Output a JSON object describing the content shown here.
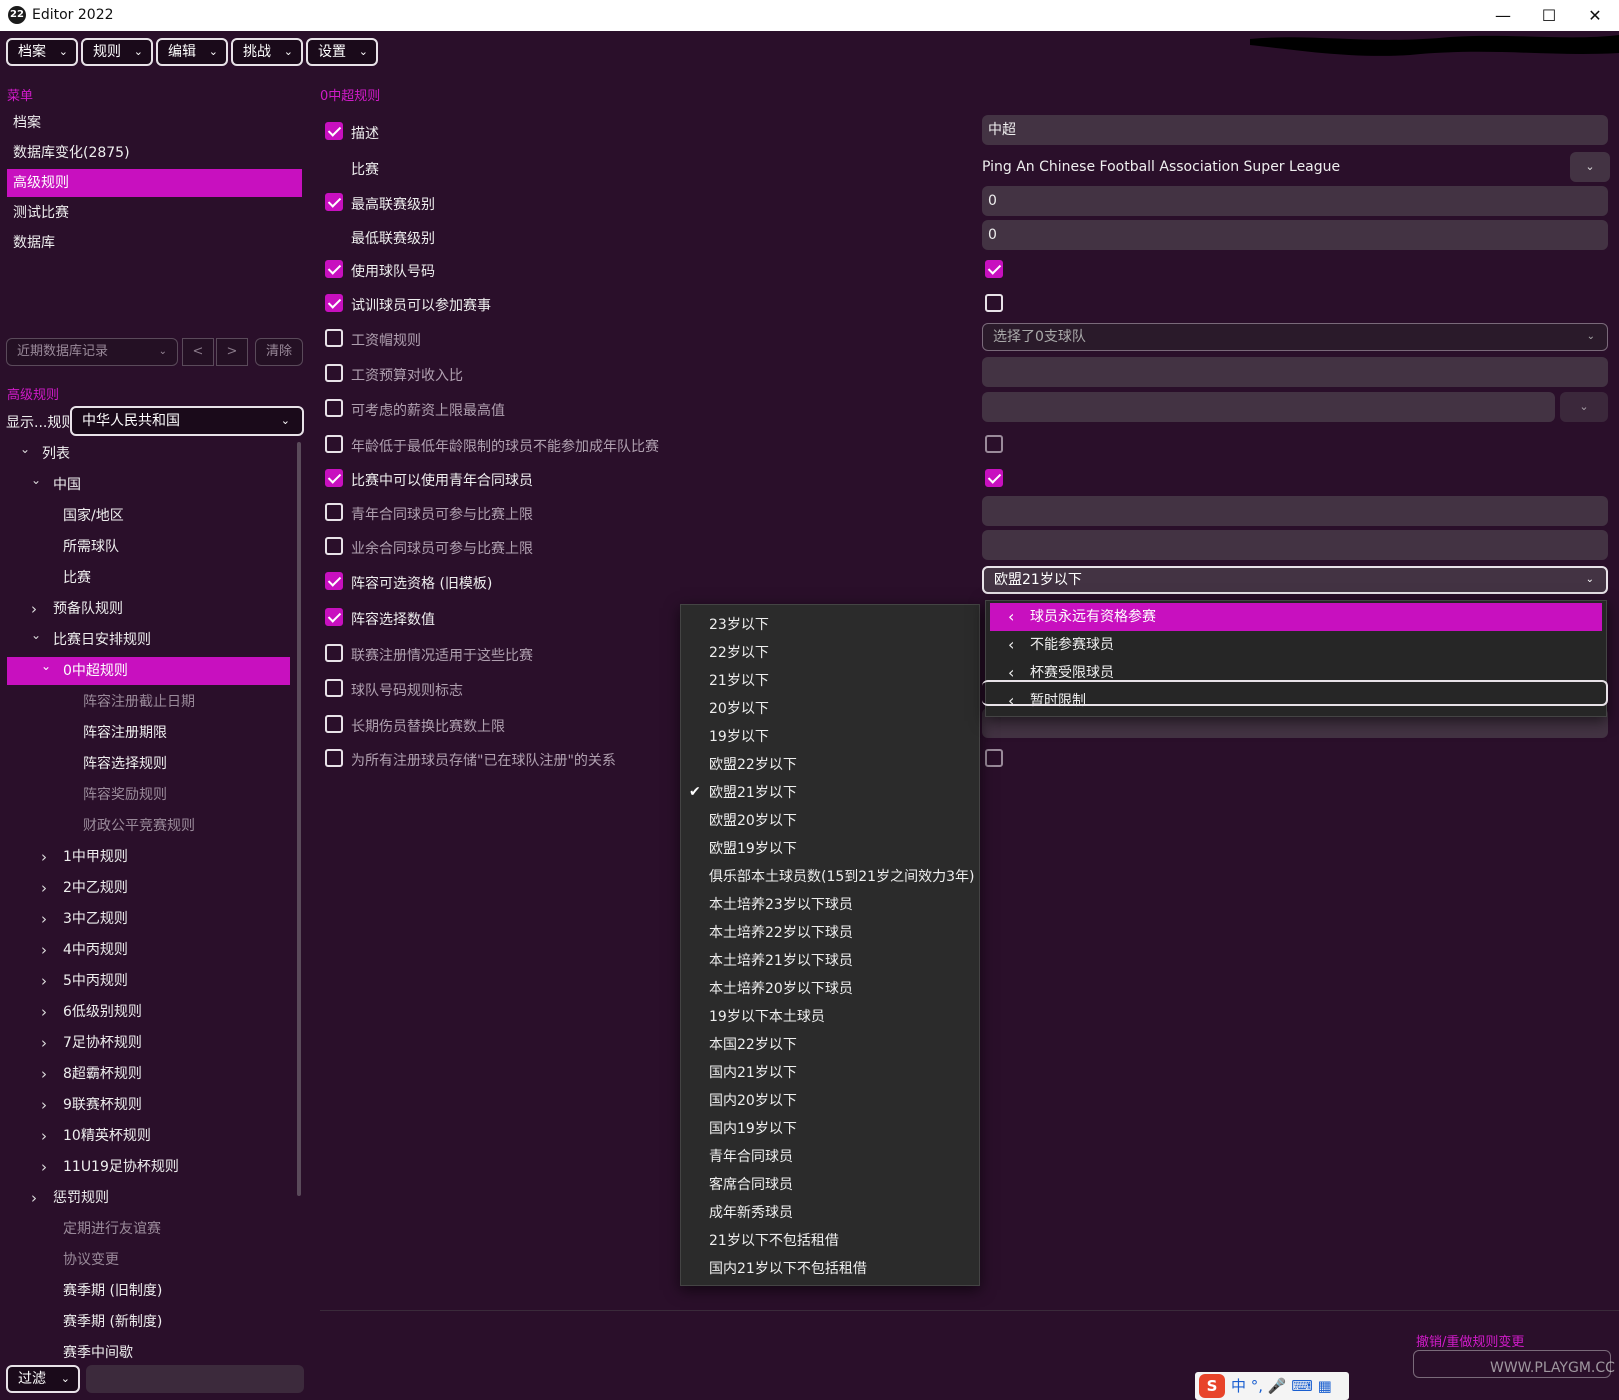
{
  "window": {
    "title": "Editor 2022",
    "icon": "22",
    "minimize": "—",
    "maximize": "☐",
    "close": "✕"
  },
  "menubar": [
    {
      "label": "档案"
    },
    {
      "label": "规则"
    },
    {
      "label": "编辑"
    },
    {
      "label": "挑战"
    },
    {
      "label": "设置"
    }
  ],
  "left": {
    "menu_label": "菜单",
    "nav": [
      "档案",
      "数据库变化(2875)",
      "高级规则",
      "测试比赛",
      "数据库"
    ],
    "history_placeholder": "近期数据库记录",
    "prev": "<",
    "next": ">",
    "clear": "清除",
    "advanced_label": "高级规则",
    "show_label": "显示...规则",
    "country": "中华人民共和国",
    "tree": [
      {
        "label": "列表",
        "level": 0,
        "chev": "open"
      },
      {
        "label": "中国",
        "level": 1,
        "chev": "open"
      },
      {
        "label": "国家/地区",
        "level": 3
      },
      {
        "label": "所需球队",
        "level": 3
      },
      {
        "label": "比赛",
        "level": 3
      },
      {
        "label": "预备队规则",
        "level": 2,
        "chev": "closed"
      },
      {
        "label": "比赛日安排规则",
        "level": 2,
        "chev": "open"
      },
      {
        "label": "0中超规则",
        "level": 3,
        "chev": "open",
        "selected": true
      },
      {
        "label": "阵容注册截止日期",
        "level": 5,
        "dim": true
      },
      {
        "label": "阵容注册期限",
        "level": 5
      },
      {
        "label": "阵容选择规则",
        "level": 5
      },
      {
        "label": "阵容奖励规则",
        "level": 5,
        "dim": true
      },
      {
        "label": "财政公平竞赛规则",
        "level": 5,
        "dim": true
      },
      {
        "label": "1中甲规则",
        "level": 3,
        "chev": "closed"
      },
      {
        "label": "2中乙规则",
        "level": 3,
        "chev": "closed"
      },
      {
        "label": "3中乙规则",
        "level": 3,
        "chev": "closed"
      },
      {
        "label": "4中丙规则",
        "level": 3,
        "chev": "closed"
      },
      {
        "label": "5中丙规则",
        "level": 3,
        "chev": "closed"
      },
      {
        "label": "6低级别规则",
        "level": 3,
        "chev": "closed"
      },
      {
        "label": "7足协杯规则",
        "level": 3,
        "chev": "closed"
      },
      {
        "label": "8超霸杯规则",
        "level": 3,
        "chev": "closed"
      },
      {
        "label": "9联赛杯规则",
        "level": 3,
        "chev": "closed"
      },
      {
        "label": "10精英杯规则",
        "level": 3,
        "chev": "closed"
      },
      {
        "label": "11U19足协杯规则",
        "level": 3,
        "chev": "closed"
      },
      {
        "label": "惩罚规则",
        "level": 2,
        "chev": "closed"
      },
      {
        "label": "定期进行友谊赛",
        "level": 3,
        "dim": true
      },
      {
        "label": "协议变更",
        "level": 3,
        "dim": true
      },
      {
        "label": "赛季期 (旧制度)",
        "level": 3
      },
      {
        "label": "赛季期 (新制度)",
        "level": 3
      },
      {
        "label": "赛季中间歇",
        "level": 3
      }
    ],
    "filter": "过滤"
  },
  "main": {
    "title": "0中超规则",
    "rows": [
      {
        "label": "描述",
        "checked": true,
        "value_type": "text",
        "value": "中超"
      },
      {
        "label": "比赛",
        "checked": null,
        "value_type": "plain",
        "value": "Ping An Chinese Football Association Super League"
      },
      {
        "label": "最高联赛级别",
        "checked": true,
        "value_type": "text",
        "value": "0"
      },
      {
        "label": "最低联赛级别",
        "checked": null,
        "value_type": "text",
        "value": "0"
      },
      {
        "label": "使用球队号码",
        "checked": true,
        "value_type": "check",
        "value": true
      },
      {
        "label": "试训球员可以参加赛事",
        "checked": true,
        "value_type": "check",
        "value": false
      },
      {
        "label": "工资帽规则",
        "checked": false,
        "dim": true,
        "value_type": "select",
        "value": "选择了0支球队"
      },
      {
        "label": "工资预算对收入比",
        "checked": false,
        "dim": true,
        "value_type": "empty"
      },
      {
        "label": "可考虑的薪资上限最高值",
        "checked": false,
        "dim": true,
        "value_type": "empty_dd"
      },
      {
        "label": "年龄低于最低年龄限制的球员不能参加成年队比赛",
        "checked": false,
        "dim": true,
        "value_type": "check_dim",
        "value": false
      },
      {
        "label": "比赛中可以使用青年合同球员",
        "checked": true,
        "value_type": "check",
        "value": true
      },
      {
        "label": "青年合同球员可参与比赛上限",
        "checked": false,
        "dim": true,
        "value_type": "empty"
      },
      {
        "label": "业余合同球员可参与比赛上限",
        "checked": false,
        "dim": true,
        "value_type": "empty"
      },
      {
        "label": "阵容可选资格 (旧模板)",
        "checked": true,
        "value_type": "select_bright",
        "value": "欧盟21岁以下"
      },
      {
        "label": "阵容选择数值",
        "checked": true,
        "value_type": "none"
      },
      {
        "label": "联赛注册情况适用于这些比赛",
        "checked": false,
        "dim": true,
        "value_type": "none"
      },
      {
        "label": "球队号码规则标志",
        "checked": false,
        "dim": true,
        "value_type": "none"
      },
      {
        "label": "长期伤员替换比赛数上限",
        "checked": false,
        "dim": true,
        "value_type": "empty"
      },
      {
        "label": "为所有注册球员存储\"已在球队注册\"的关系",
        "checked": false,
        "dim": true,
        "value_type": "check_dim",
        "value": false
      }
    ]
  },
  "dropdown": {
    "selected": "欧盟21岁以下",
    "items": [
      "23岁以下",
      "22岁以下",
      "21岁以下",
      "20岁以下",
      "19岁以下",
      "欧盟22岁以下",
      "欧盟21岁以下",
      "欧盟20岁以下",
      "欧盟19岁以下",
      "俱乐部本土球员数(15到21岁之间效力3年)",
      "本土培养23岁以下球员",
      "本土培养22岁以下球员",
      "本土培养21岁以下球员",
      "本土培养20岁以下球员",
      "19岁以下本土球员",
      "本国22岁以下",
      "国内21岁以下",
      "国内20岁以下",
      "国内19岁以下",
      "青年合同球员",
      "客席合同球员",
      "成年新秀球员",
      "21岁以下不包括租借",
      "国内21岁以下不包括租借"
    ]
  },
  "submenu": {
    "items": [
      "球员永远有资格参赛",
      "不能参赛球员",
      "杯赛受限球员",
      "暂时限制"
    ]
  },
  "footer": {
    "undo": "撤销/重做规则变更"
  },
  "ime": {
    "logo": "S",
    "text": "中 °, 🎤 ⌨ ▦"
  },
  "watermark": "WWW.PLAYGM.CC",
  "colors": {
    "accent": "#c810bf",
    "background": "#2a0f2a",
    "field": "#433343"
  }
}
